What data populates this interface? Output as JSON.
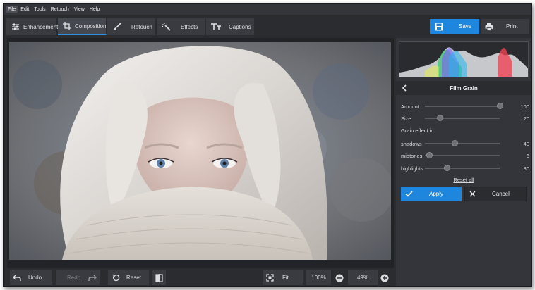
{
  "menu": [
    "File",
    "Edit",
    "Tools",
    "Retouch",
    "View",
    "Help"
  ],
  "tabs": [
    {
      "label": "Enhancement",
      "icon": "sliders-icon"
    },
    {
      "label": "Composition",
      "icon": "crop-icon"
    },
    {
      "label": "Retouch",
      "icon": "brush-icon"
    },
    {
      "label": "Effects",
      "icon": "magic-wand-icon"
    },
    {
      "label": "Captions",
      "icon": "text-icon"
    }
  ],
  "actions": {
    "save": "Save",
    "print": "Print"
  },
  "bottom": {
    "undo": "Undo",
    "redo": "Redo",
    "reset": "Reset",
    "fit": "Fit",
    "zoom_full": "100%",
    "zoom": "49%"
  },
  "panel": {
    "title": "Film Grain",
    "amount": {
      "label": "Amount",
      "value": "100",
      "level": 1.0
    },
    "size": {
      "label": "Size",
      "value": "20",
      "level": 0.2
    },
    "section": "Grain effect in:",
    "shadows": {
      "label": "shadows",
      "value": "40",
      "level": 0.4
    },
    "midtones": {
      "label": "midtones",
      "value": "6",
      "level": 0.06
    },
    "highlights": {
      "label": "highlights",
      "value": "30",
      "level": 0.3
    },
    "reset_all": "Reset all",
    "apply": "Apply",
    "cancel": "Cancel"
  },
  "colors": {
    "accent": "#1f86dd",
    "panel": "#34353a",
    "window": "#2b2c30"
  }
}
